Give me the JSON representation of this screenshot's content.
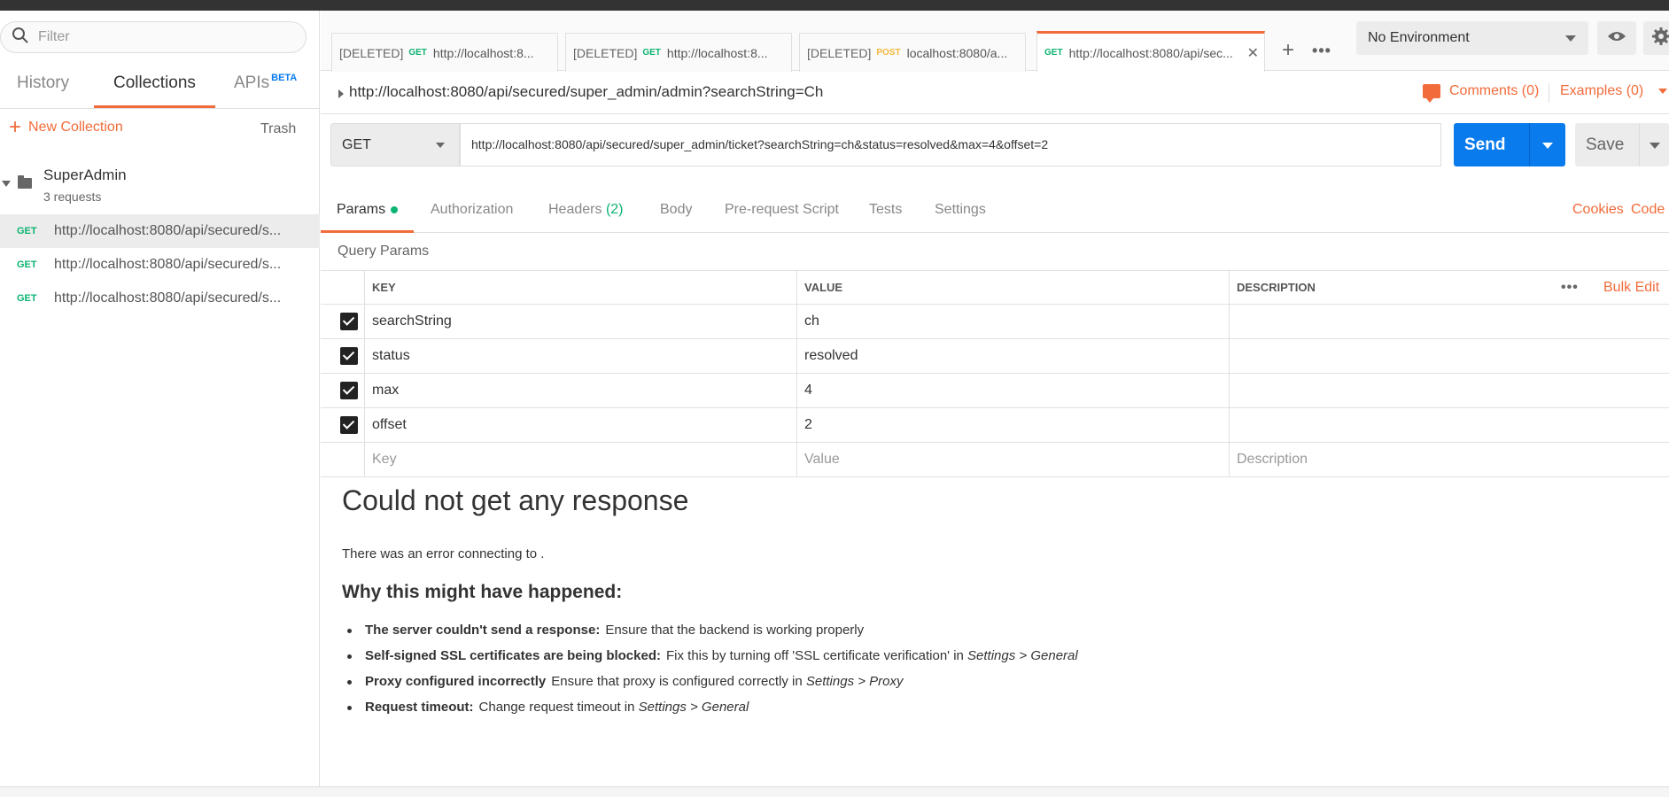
{
  "sidebar": {
    "filter_placeholder": "Filter",
    "tabs": [
      {
        "label": "History"
      },
      {
        "label": "Collections"
      },
      {
        "label": "APIs"
      }
    ],
    "apis_badge": "BETA",
    "new_collection": "New Collection",
    "trash": "Trash",
    "collection": {
      "name": "SuperAdmin",
      "count": "3 requests"
    },
    "requests": [
      {
        "method": "GET",
        "url": "http://localhost:8080/api/secured/s..."
      },
      {
        "method": "GET",
        "url": "http://localhost:8080/api/secured/s..."
      },
      {
        "method": "GET",
        "url": "http://localhost:8080/api/secured/s..."
      }
    ]
  },
  "tabs": [
    {
      "deleted": "[DELETED]",
      "method": "GET",
      "title": "http://localhost:8..."
    },
    {
      "deleted": "[DELETED]",
      "method": "GET",
      "title": "http://localhost:8..."
    },
    {
      "deleted": "[DELETED]",
      "method": "POST",
      "title": "localhost:8080/a..."
    },
    {
      "method": "GET",
      "title": "http://localhost:8080/api/sec..."
    }
  ],
  "environment": {
    "selected": "No Environment"
  },
  "request": {
    "title": "http://localhost:8080/api/secured/super_admin/admin?searchString=Ch",
    "comments": "Comments (0)",
    "examples": "Examples (0)",
    "method": "GET",
    "url": "http://localhost:8080/api/secured/super_admin/ticket?searchString=ch&status=resolved&max=4&offset=2",
    "send": "Send",
    "save": "Save"
  },
  "subtabs": {
    "params": "Params",
    "authorization": "Authorization",
    "headers": "Headers",
    "headers_count": "(2)",
    "body": "Body",
    "prerequest": "Pre-request Script",
    "tests": "Tests",
    "settings": "Settings",
    "cookies": "Cookies",
    "code": "Code"
  },
  "params": {
    "section_label": "Query Params",
    "headers": {
      "key": "KEY",
      "value": "VALUE",
      "description": "DESCRIPTION"
    },
    "bulk_edit": "Bulk Edit",
    "rows": [
      {
        "key": "searchString",
        "value": "ch"
      },
      {
        "key": "status",
        "value": "resolved"
      },
      {
        "key": "max",
        "value": "4"
      },
      {
        "key": "offset",
        "value": "2"
      }
    ],
    "placeholders": {
      "key": "Key",
      "value": "Value",
      "description": "Description"
    }
  },
  "response": {
    "title": "Could not get any response",
    "error": "There was an error connecting to .",
    "why": "Why this might have happened:",
    "reasons": [
      {
        "bold": "The server couldn't send a response:",
        "text": "Ensure that the backend is working properly",
        "italic": ""
      },
      {
        "bold": "Self-signed SSL certificates are being blocked:",
        "text": "Fix this by turning off 'SSL certificate verification' in",
        "italic": "Settings > General"
      },
      {
        "bold": "Proxy configured incorrectly",
        "text": "Ensure that proxy is configured correctly in",
        "italic": "Settings > Proxy"
      },
      {
        "bold": "Request timeout:",
        "text": "Change request timeout in",
        "italic": "Settings > General"
      }
    ]
  },
  "colors": {
    "accent": "#f26b3a",
    "send": "#097bed",
    "get": "#0cb371",
    "post": "#f2b73a"
  }
}
